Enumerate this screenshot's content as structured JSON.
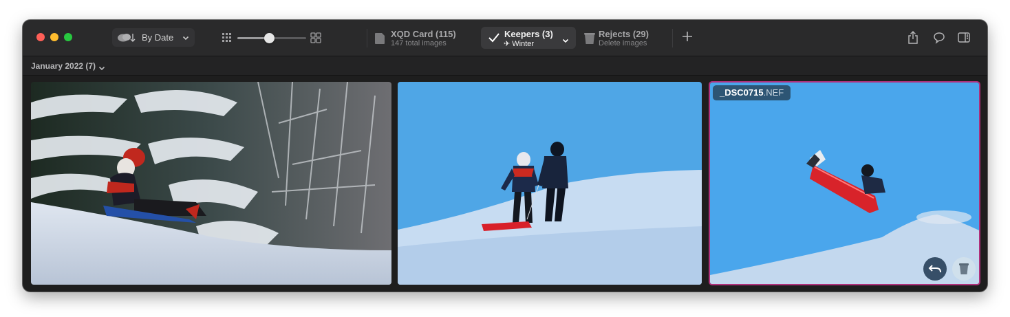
{
  "toolbar": {
    "sort_label": "By Date",
    "tabs": [
      {
        "title": "XQD Card (115)",
        "subtitle": "147 total images"
      },
      {
        "title": "Keepers (3)",
        "subtitle": "Winter"
      },
      {
        "title": "Rejects (29)",
        "subtitle": "Delete images"
      }
    ],
    "zoom_level": 0.46,
    "icons": {
      "sort": "cloud-sort-icon",
      "zoom_small": "small-grid-icon",
      "zoom_large": "large-grid-icon",
      "card": "card-icon",
      "keepers": "checkmark-icon",
      "rejects": "trash-icon",
      "add": "plus-icon",
      "share": "share-icon",
      "comment": "speech-bubble-icon",
      "sidebar": "sidebar-icon"
    }
  },
  "group": {
    "label": "January 2022 (7)"
  },
  "photos": [
    {
      "description": "child sledding"
    },
    {
      "description": "two children walking"
    },
    {
      "filename_base": "_DSC0715",
      "filename_ext": ".NEF",
      "selected": true
    }
  ],
  "colors": {
    "selection": "#b0307a",
    "red": "#fe5f57",
    "yellow": "#febc2e",
    "green": "#28c840"
  }
}
